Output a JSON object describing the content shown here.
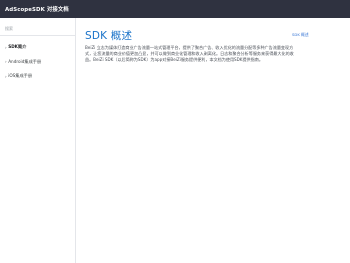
{
  "header": {
    "app_title": "AdScopeSDK 对接文档"
  },
  "sidebar": {
    "search_placeholder": "搜索",
    "items": [
      {
        "label": "SDK简介",
        "active": true
      },
      {
        "label": "Android集成手册",
        "active": false
      },
      {
        "label": "iOS集成手册",
        "active": false
      }
    ]
  },
  "main": {
    "title": "SDK 概述",
    "toc_link": "SDK 概述",
    "paragraph": "BeiZi 立志为媒体打造商业广告流量一站式管理平台，提供了聚合广告、收入优化的流量分配等多种广告流量变现方式，让您流量的商业价值更加凸显，并可以做到商业化管理和收入剥离化。日志和聚合分析等服务来获得最大化的收益。BeiZi SDK（以后简称为SDK）为app对接BeiZi服务提供便利，本文档为使用SDK提供指南。"
  }
}
